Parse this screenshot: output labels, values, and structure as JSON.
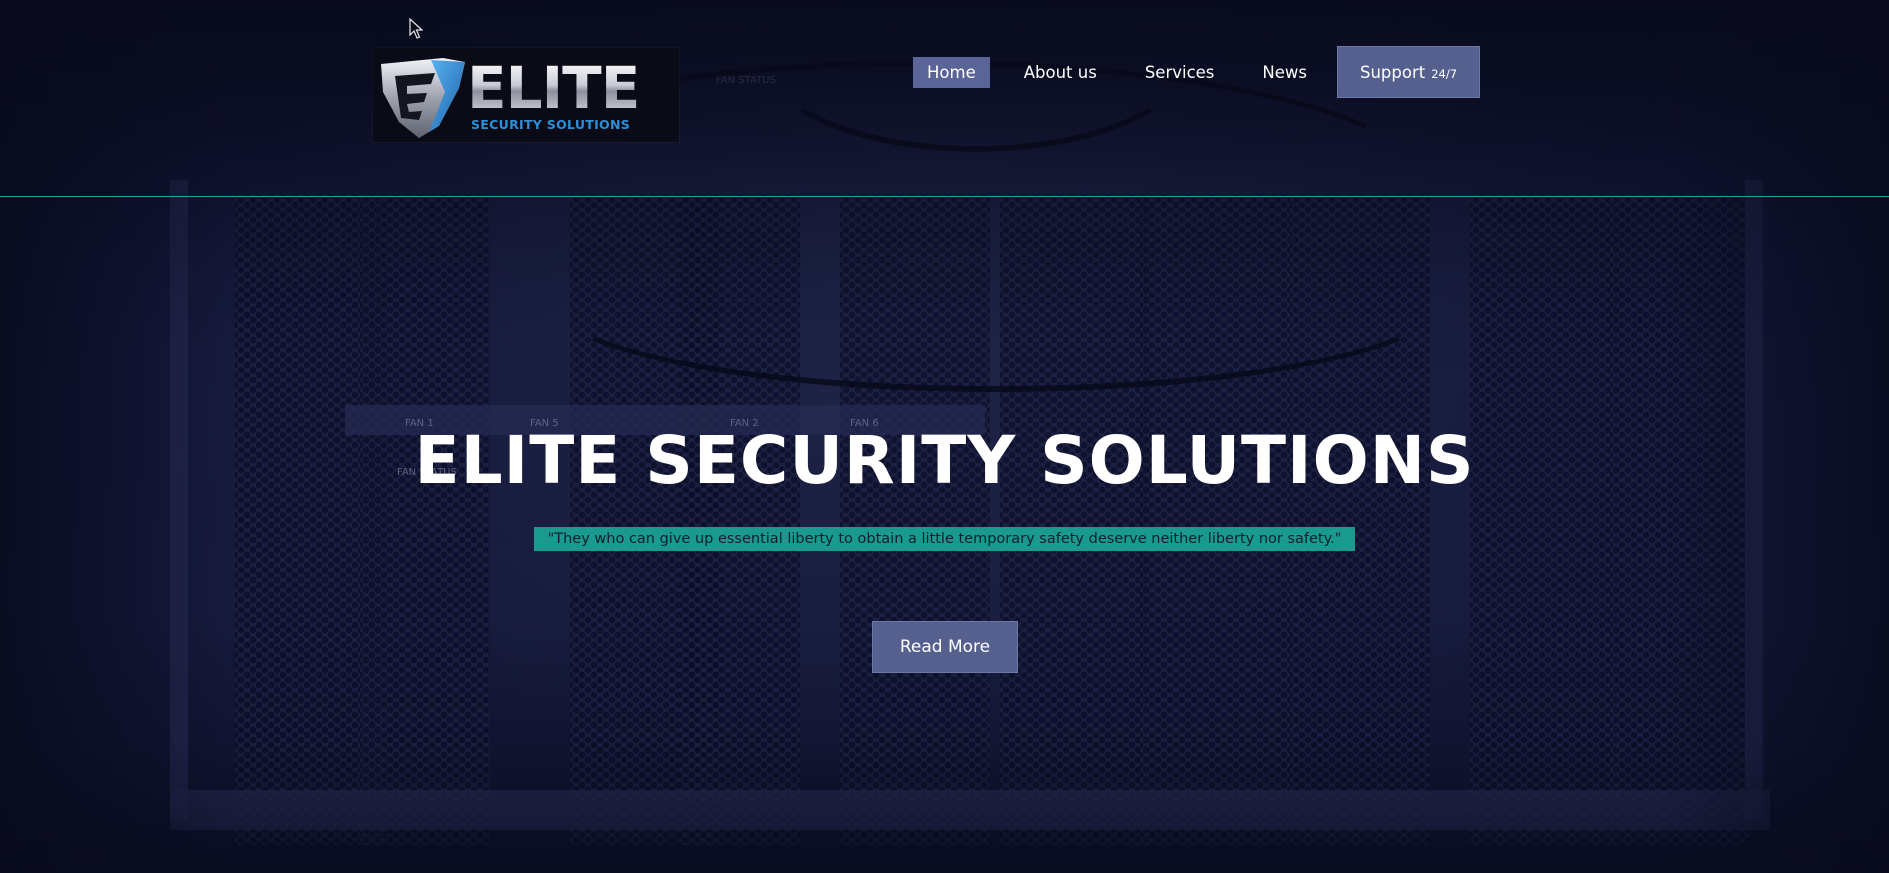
{
  "brand": {
    "logo_word": "ELITE",
    "logo_tagline": "SECURITY SOLUTIONS"
  },
  "nav": {
    "items": [
      {
        "label": "Home",
        "active": true
      },
      {
        "label": "About us",
        "active": false
      },
      {
        "label": "Services",
        "active": false
      },
      {
        "label": "News",
        "active": false
      }
    ],
    "support": {
      "label": "Support",
      "sublabel": "24/7"
    }
  },
  "hero": {
    "title": "ELITE SECURITY SOLUTIONS",
    "quote": "\"They who can give up essential liberty to obtain a little temporary safety deserve neither liberty nor safety.\"",
    "cta_label": "Read More"
  },
  "background_labels": {
    "fan_1": "FAN 1",
    "fan_5": "FAN 5",
    "fan_2": "FAN 2",
    "fan_6": "FAN 6",
    "fan_status": "FAN STATUS",
    "fan_status_top": "FAN STATUS"
  },
  "colors": {
    "accent_teal": "#1a9a8e",
    "button_bg": "#55608f",
    "nav_active_bg": "#5a6496",
    "header_rule": "#1fa39a",
    "logo_blue": "#2c8fd8"
  },
  "icons": {
    "logo_mark": "shield-e-icon",
    "cursor": "mouse-pointer-icon"
  }
}
